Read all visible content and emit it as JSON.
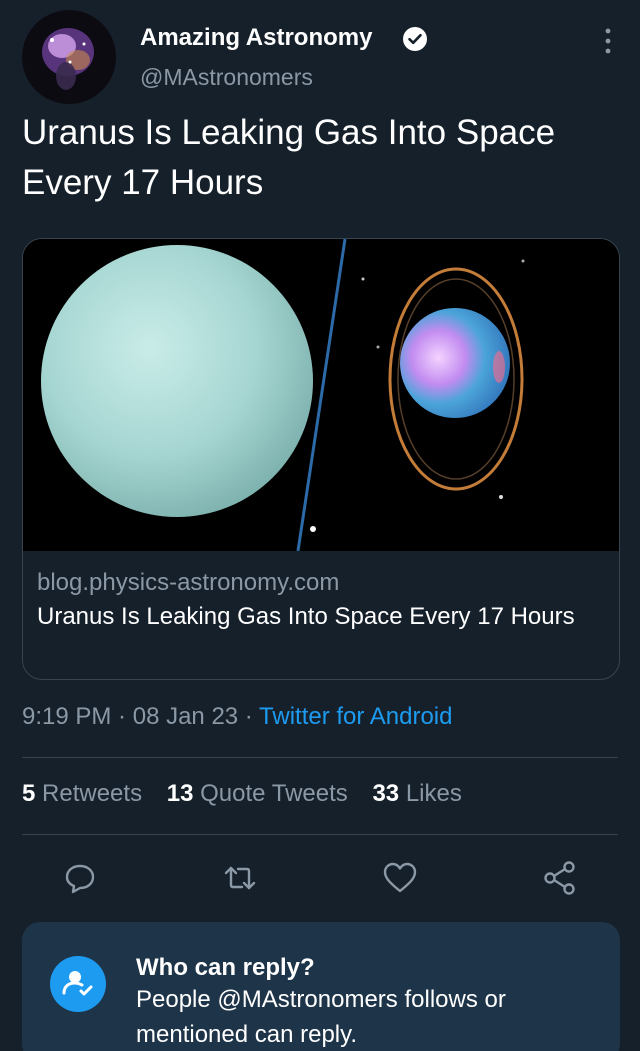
{
  "author": {
    "display_name": "Amazing Astronomy",
    "handle": "@MAstronomers",
    "verified": true
  },
  "tweet": {
    "text": "Uranus Is Leaking Gas Into Space Every 17 Hours"
  },
  "card": {
    "domain": "blog.physics-astronomy.com",
    "title": "Uranus Is Leaking Gas Into Space Every 17 Hours"
  },
  "meta": {
    "time": "9:19 PM",
    "date": "08 Jan 23",
    "separator": " · ",
    "source": "Twitter for Android"
  },
  "stats": {
    "retweets_count": "5",
    "retweets_label": "Retweets",
    "quotes_count": "13",
    "quotes_label": "Quote Tweets",
    "likes_count": "33",
    "likes_label": "Likes"
  },
  "actions": {
    "icons": [
      "reply-icon",
      "retweet-icon",
      "like-icon",
      "share-icon"
    ]
  },
  "reply_settings": {
    "title": "Who can reply?",
    "description": "People @MAstronomers follows or mentioned can reply."
  },
  "colors": {
    "background": "#15202b",
    "accent": "#1d9bf0",
    "muted_text": "#8b98a5",
    "border": "#38444d",
    "reply_box": "#1e3448"
  }
}
